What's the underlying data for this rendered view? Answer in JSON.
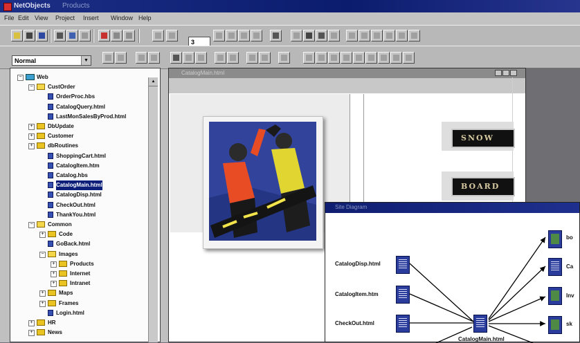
{
  "window": {
    "app_name": "NetObjects",
    "doc_name": "Products"
  },
  "menu": [
    "File",
    "Edit",
    "View",
    "Project",
    "Insert",
    "Window",
    "Help"
  ],
  "toolbar": {
    "zoom_value": "3",
    "style_value": "Normal"
  },
  "tree": {
    "items": [
      {
        "label": "Web",
        "level": 0,
        "icon": "web",
        "exp": "-"
      },
      {
        "label": "CustOrder",
        "level": 1,
        "icon": "folder-open",
        "exp": "-"
      },
      {
        "label": "OrderProc.hbs",
        "level": 2,
        "icon": "page",
        "exp": ""
      },
      {
        "label": "CatalogQuery.html",
        "level": 2,
        "icon": "page",
        "exp": ""
      },
      {
        "label": "LastMonSalesByProd.html",
        "level": 2,
        "icon": "page",
        "exp": ""
      },
      {
        "label": "DbUpdate",
        "level": 1,
        "icon": "folder",
        "exp": "+"
      },
      {
        "label": "Customer",
        "level": 1,
        "icon": "folder",
        "exp": "+"
      },
      {
        "label": "dbRoutines",
        "level": 1,
        "icon": "folder",
        "exp": "+"
      },
      {
        "label": "ShoppingCart.html",
        "level": 2,
        "icon": "page",
        "exp": ""
      },
      {
        "label": "CatalogItem.htm",
        "level": 2,
        "icon": "page",
        "exp": ""
      },
      {
        "label": "Catalog.hbs",
        "level": 2,
        "icon": "page",
        "exp": ""
      },
      {
        "label": "CatalogMain.html",
        "level": 2,
        "icon": "page",
        "exp": "",
        "selected": true
      },
      {
        "label": "CatalogDisp.html",
        "level": 2,
        "icon": "page",
        "exp": ""
      },
      {
        "label": "CheckOut.html",
        "level": 2,
        "icon": "page",
        "exp": ""
      },
      {
        "label": "ThankYou.html",
        "level": 2,
        "icon": "page",
        "exp": ""
      },
      {
        "label": "Common",
        "level": 1,
        "icon": "folder-open",
        "exp": "-"
      },
      {
        "label": "Code",
        "level": 2,
        "icon": "folder",
        "exp": "+"
      },
      {
        "label": "GoBack.html",
        "level": 2,
        "icon": "page",
        "exp": ""
      },
      {
        "label": "Images",
        "level": 2,
        "icon": "folder-open",
        "exp": "-"
      },
      {
        "label": "Products",
        "level": 3,
        "icon": "folder",
        "exp": "+"
      },
      {
        "label": "Internet",
        "level": 3,
        "icon": "folder",
        "exp": "+"
      },
      {
        "label": "Intranet",
        "level": 3,
        "icon": "folder",
        "exp": "+"
      },
      {
        "label": "Maps",
        "level": 2,
        "icon": "folder",
        "exp": "+"
      },
      {
        "label": "Frames",
        "level": 2,
        "icon": "folder",
        "exp": "+"
      },
      {
        "label": "Login.html",
        "level": 2,
        "icon": "page",
        "exp": ""
      },
      {
        "label": "HR",
        "level": 1,
        "icon": "folder",
        "exp": "+"
      },
      {
        "label": "News",
        "level": 1,
        "icon": "folder",
        "exp": "+"
      }
    ]
  },
  "editor": {
    "title": "CatalogMain.html",
    "nav_buttons": [
      "SNOW",
      "BOARD"
    ]
  },
  "diagram": {
    "title": "Site Diagram",
    "left_nodes": [
      "CatalogDisp.html",
      "CatalogItem.htm",
      "CheckOut.html"
    ],
    "center_label": "CatalogMain.html",
    "right_nodes": [
      "bo",
      "Ca",
      "Inv",
      "sk"
    ]
  },
  "colors": {
    "title_bar": "#1c2f86",
    "selection": "#0b1f7a",
    "chrome": "#c0c0c0"
  }
}
